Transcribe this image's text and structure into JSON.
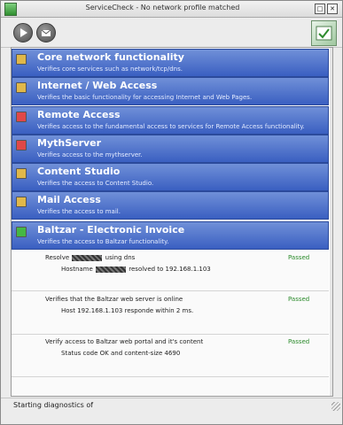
{
  "window": {
    "title": "ServiceCheck - No network profile matched",
    "minimize_label": "□",
    "close_label": "✕"
  },
  "toolbar": {
    "play_icon": "play-icon",
    "email_icon": "email-icon"
  },
  "groups": [
    {
      "name": "Core network functionality",
      "desc": "Verifies core services such as network/tcp/dns.",
      "color": "#e0b84a"
    },
    {
      "name": "Internet / Web Access",
      "desc": "Verifies the basic functionality for accessing Internet and Web Pages.",
      "color": "#e0b84a"
    },
    {
      "name": "Remote Access",
      "desc": "Verifies access to the fundamental access to services for Remote Access functionality.",
      "color": "#e04848"
    },
    {
      "name": "MythServer",
      "desc": "Verifies access to the mythserver.",
      "color": "#e04848"
    },
    {
      "name": "Content Studio",
      "desc": "Verifies the access to Content Studio.",
      "color": "#e0b84a"
    },
    {
      "name": "Mail Access",
      "desc": "Verifies the access to mail.",
      "color": "#e0b84a"
    },
    {
      "name": "Baltzar - Electronic Invoice",
      "desc": "Verifies the access to Baltzar functionality.",
      "color": "#45b845"
    }
  ],
  "checks": [
    {
      "title_pre": "Resolve",
      "title_post": "using dns",
      "detail_pre": "Hostname",
      "detail_post": "resolved to 192.168.1.103",
      "status": "Passed"
    },
    {
      "title": "Verifies that the Baltzar web server is online",
      "detail": "Host 192.168.1.103 responde within 2 ms.",
      "status": "Passed"
    },
    {
      "title": "Verify access to Baltzar web portal and it's content",
      "detail": "Status code OK and content-size 4690",
      "status": "Passed"
    }
  ],
  "status_bar": {
    "text": "Starting diagnostics of"
  }
}
